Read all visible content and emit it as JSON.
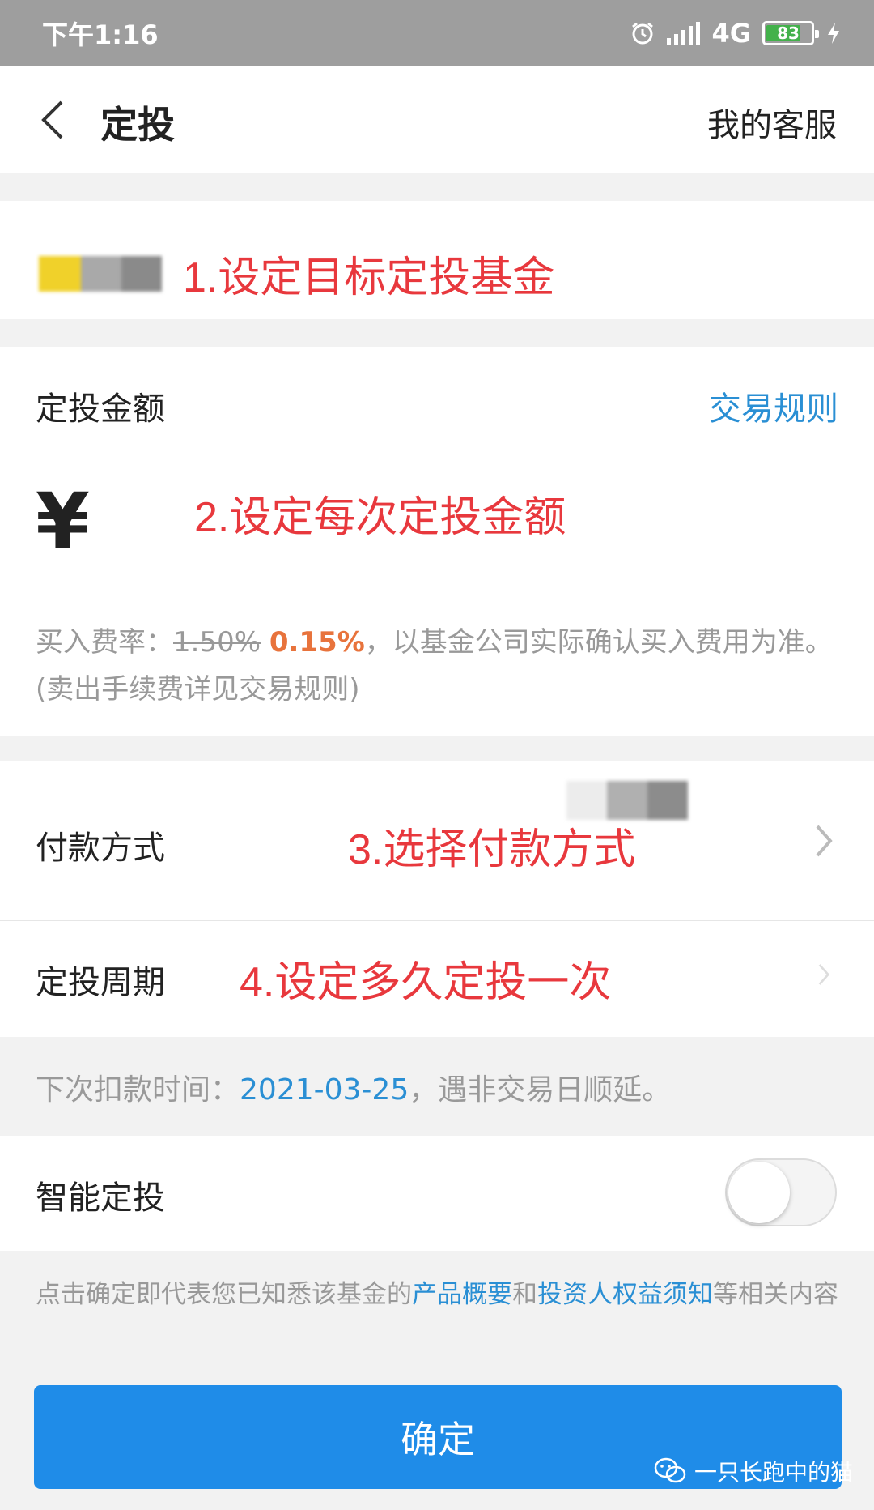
{
  "status_bar": {
    "time": "下午1:16",
    "network": "4G",
    "battery": "83",
    "icons": [
      "alarm-icon",
      "signal-icon",
      "battery-icon",
      "charging-icon"
    ]
  },
  "header": {
    "title": "定投",
    "service_label": "我的客服"
  },
  "annotations": {
    "step1": "1.设定目标定投基金",
    "step2": "2.设定每次定投金额",
    "step3": "3.选择付款方式",
    "step4": "4.设定多久定投一次"
  },
  "amount": {
    "label": "定投金额",
    "rules_link": "交易规则",
    "currency": "¥",
    "fee_prefix": "买入费率：",
    "fee_old": "1.50%",
    "fee_new": "0.15%",
    "fee_suffix": "，以基金公司实际确认买入费用为准。(卖出手续费详见交易规则)"
  },
  "payment": {
    "method_label": "付款方式",
    "period_label": "定投周期"
  },
  "next_debit": {
    "prefix": "下次扣款时间：",
    "date": "2021-03-25",
    "suffix": "，遇非交易日顺延。"
  },
  "smart": {
    "label": "智能定投",
    "enabled": false
  },
  "disclaimer": {
    "prefix": "点击确定即代表您已知悉该基金的",
    "link1": "产品概要",
    "mid": "和",
    "link2": "投资人权益须知",
    "suffix": "等相关内容"
  },
  "confirm_label": "确定",
  "watermark": "一只长跑中的猫",
  "colors": {
    "accent_blue": "#1f8ce8",
    "link_blue": "#2a8fd4",
    "annotation_red": "#e8383d",
    "fee_orange": "#e8733c",
    "status_bar_gray": "#9e9e9e"
  }
}
